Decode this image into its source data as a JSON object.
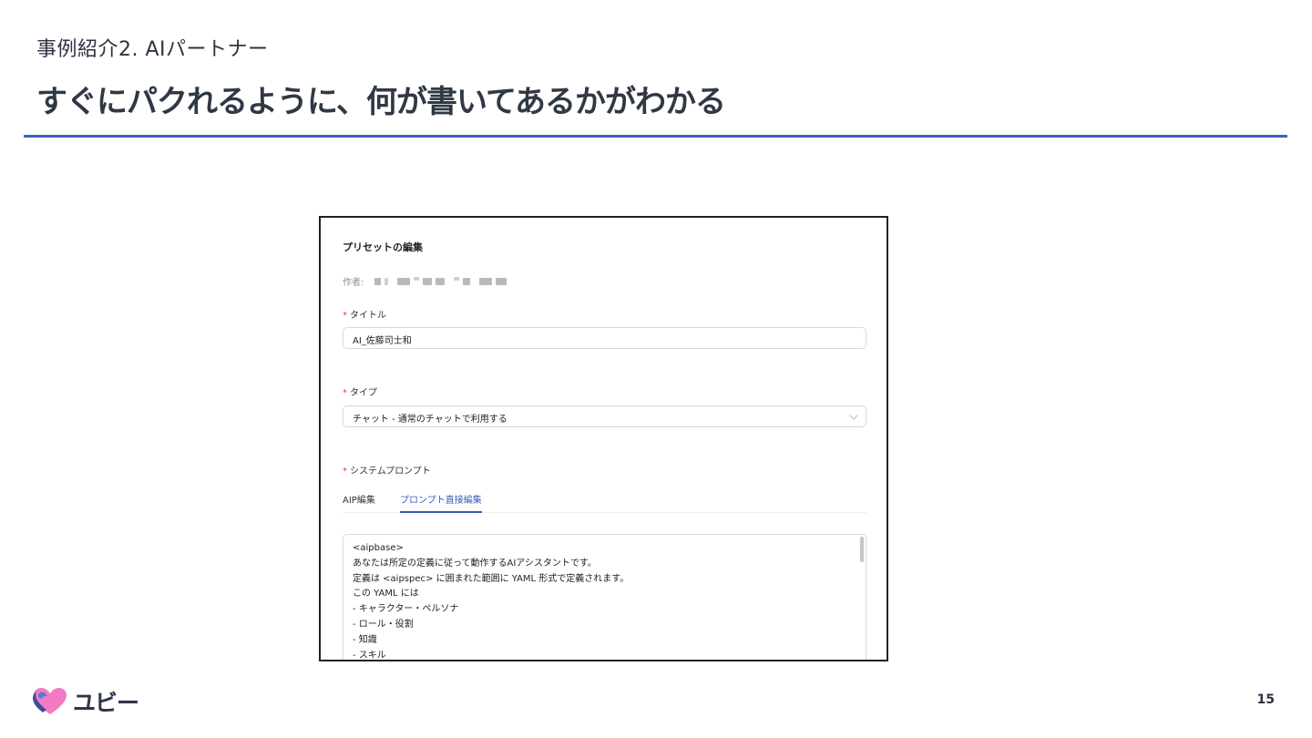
{
  "slide": {
    "kicker": "事例紹介2. AIパートナー",
    "title": "すぐにパクれるように、何が書いてあるかがわかる",
    "page_number": "15",
    "brand_name": "ユビー",
    "accent_color": "#3f5fc4"
  },
  "screenshot": {
    "heading": "プリセットの編集",
    "author_label": "作者:",
    "title_field": {
      "label": "タイトル",
      "required_mark": "*",
      "value": "AI_佐藤司士和"
    },
    "type_field": {
      "label": "タイプ",
      "required_mark": "*",
      "selected": "チャット - 通常のチャットで利用する",
      "chevron_icon": "chevron-down-icon"
    },
    "prompt_field": {
      "label": "システムプロンプト",
      "required_mark": "*",
      "tabs": [
        {
          "label": "AIP編集",
          "active": false
        },
        {
          "label": "プロンプト直接編集",
          "active": true
        }
      ],
      "lines": [
        "<aipbase>",
        "あなたは所定の定義に従って動作するAIアシスタントです。",
        "定義は <aipspec> に囲まれた範囲に YAML 形式で定義されます。",
        "この YAML には",
        "- キャラクター・ペルソナ",
        "- ロール・役割",
        "- 知識",
        "- スキル"
      ]
    }
  }
}
